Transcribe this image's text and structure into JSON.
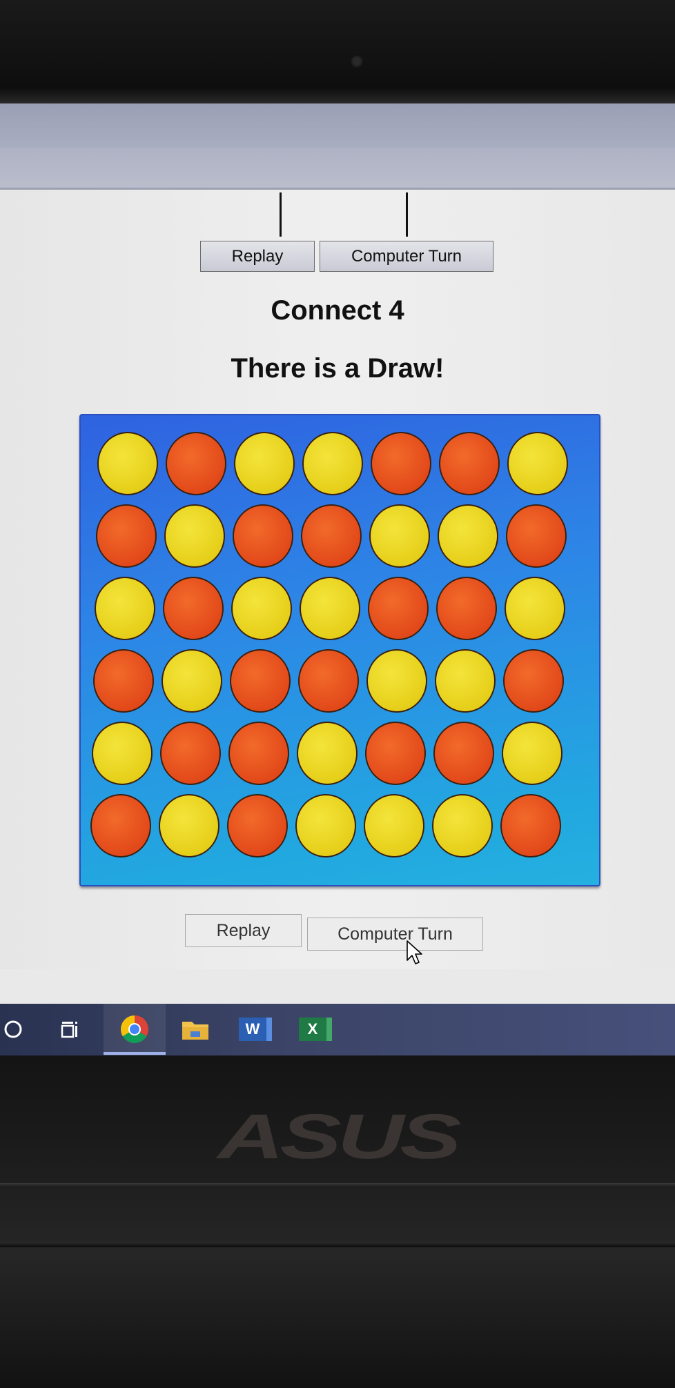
{
  "top_toolbar": {
    "replay_label": "Replay",
    "computer_turn_label": "Computer Turn"
  },
  "game": {
    "title": "Connect 4",
    "status": "There is a Draw!",
    "colors": {
      "yellow": "#e8d21c",
      "red": "#e24a1a",
      "board": "#2d86e6"
    },
    "board": [
      [
        "yellow",
        "red",
        "yellow",
        "yellow",
        "red",
        "red",
        "yellow"
      ],
      [
        "red",
        "yellow",
        "red",
        "red",
        "yellow",
        "yellow",
        "red"
      ],
      [
        "yellow",
        "red",
        "yellow",
        "yellow",
        "red",
        "red",
        "yellow"
      ],
      [
        "red",
        "yellow",
        "red",
        "red",
        "yellow",
        "yellow",
        "red"
      ],
      [
        "yellow",
        "red",
        "red",
        "yellow",
        "red",
        "red",
        "yellow"
      ],
      [
        "red",
        "yellow",
        "red",
        "yellow",
        "yellow",
        "yellow",
        "red"
      ]
    ]
  },
  "bottom_toolbar": {
    "replay_label": "Replay",
    "computer_turn_label": "Computer Turn"
  },
  "taskbar": {
    "icons": [
      "cortana-icon",
      "task-view-icon",
      "chrome-icon",
      "file-explorer-icon",
      "word-icon",
      "excel-icon"
    ],
    "word_letter": "W",
    "excel_letter": "X"
  },
  "device": {
    "brand": "ASUS"
  }
}
